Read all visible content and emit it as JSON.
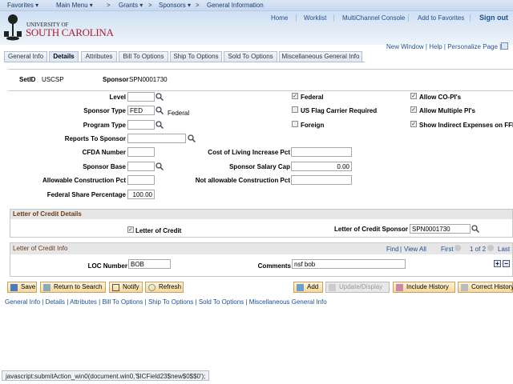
{
  "nav": {
    "favorites": "Favorites ▾",
    "main_menu": "Main Menu ▾",
    "sep1": ">",
    "grants": "Grants ▾",
    "sep2": ">",
    "sponsors": "Sponsors ▾",
    "sep3": ">",
    "current": "General Information"
  },
  "header": {
    "logo_line1": "UNIVERSITY OF",
    "logo_line2": "SOUTH CAROLINA",
    "links": [
      "Home",
      "Worklist",
      "MultiChannel Console",
      "Add to Favorites"
    ],
    "sign_out": "Sign out"
  },
  "utility": {
    "new_window": "New Window",
    "help": "Help",
    "personalize": "Personalize Page"
  },
  "tabs": [
    "General Info",
    "Details",
    "Attributes",
    "Bill To Options",
    "Ship To Options",
    "Sold To Options",
    "Miscellaneous General Info"
  ],
  "active_tab": "Details",
  "keys": {
    "setid_label": "SetID",
    "setid": "USCSP",
    "sponsor_label": "Sponsor",
    "sponsor": "SPN0001730"
  },
  "form": {
    "level": {
      "label": "Level",
      "value": ""
    },
    "sponsor_type": {
      "label": "Sponsor Type",
      "value": "FED",
      "desc": "Federal"
    },
    "program_type": {
      "label": "Program Type",
      "value": ""
    },
    "reports_to": {
      "label": "Reports To Sponsor",
      "value": ""
    },
    "cfda": {
      "label": "CFDA Number",
      "value": ""
    },
    "sponsor_base": {
      "label": "Sponsor Base",
      "value": ""
    },
    "allow_const": {
      "label": "Allowable Construction Pct",
      "value": ""
    },
    "fed_share": {
      "label": "Federal Share Percentage",
      "value": "100.00"
    },
    "cola": {
      "label": "Cost of Living Increase Pct",
      "value": ""
    },
    "salary_cap": {
      "label": "Sponsor Salary Cap",
      "value": "0.00"
    },
    "not_allow_const": {
      "label": "Not allowable Construction Pct",
      "value": ""
    }
  },
  "checkboxes": [
    {
      "label": "Federal",
      "checked": true
    },
    {
      "label": "US Flag Carrier Required",
      "checked": false
    },
    {
      "label": "Foreign",
      "checked": false
    },
    {
      "label": "Allow CO-PI's",
      "checked": true
    },
    {
      "label": "Allow Multiple PI's",
      "checked": true
    },
    {
      "label": "Show Indirect Expenses on FFR",
      "checked": true
    }
  ],
  "loc_details": {
    "title": "Letter of Credit Details",
    "loc_label": "Letter of Credit",
    "loc_checked": true,
    "loc_sponsor_label": "Letter of Credit Sponsor",
    "loc_sponsor": "SPN0001730"
  },
  "loc_info": {
    "title": "Letter of Credit Info",
    "find": "Find",
    "view_all": "View All",
    "first": "First",
    "pager": "1 of 2",
    "last": "Last",
    "loc_number_label": "LOC Number",
    "loc_number": "BOB",
    "comments_label": "Comments",
    "comments": "nsf bob"
  },
  "buttons": {
    "save": "Save",
    "return": "Return to Search",
    "notify": "Notify",
    "refresh": "Refresh",
    "add": "Add",
    "update": "Update/Display",
    "include": "Include History",
    "correct": "Correct History"
  },
  "bottom_links": [
    "General Info",
    "Details",
    "Attributes",
    "Bill To Options",
    "Ship To Options",
    "Sold To Options",
    "Miscellaneous General Info"
  ],
  "status_bar": "javascript:submitAction_win0(document.win0,'$ICField23$new$0$$0');",
  "colors": {
    "link": "#1d4f91",
    "brand_red": "#b01c2e",
    "section_title": "#6b3a1a"
  }
}
